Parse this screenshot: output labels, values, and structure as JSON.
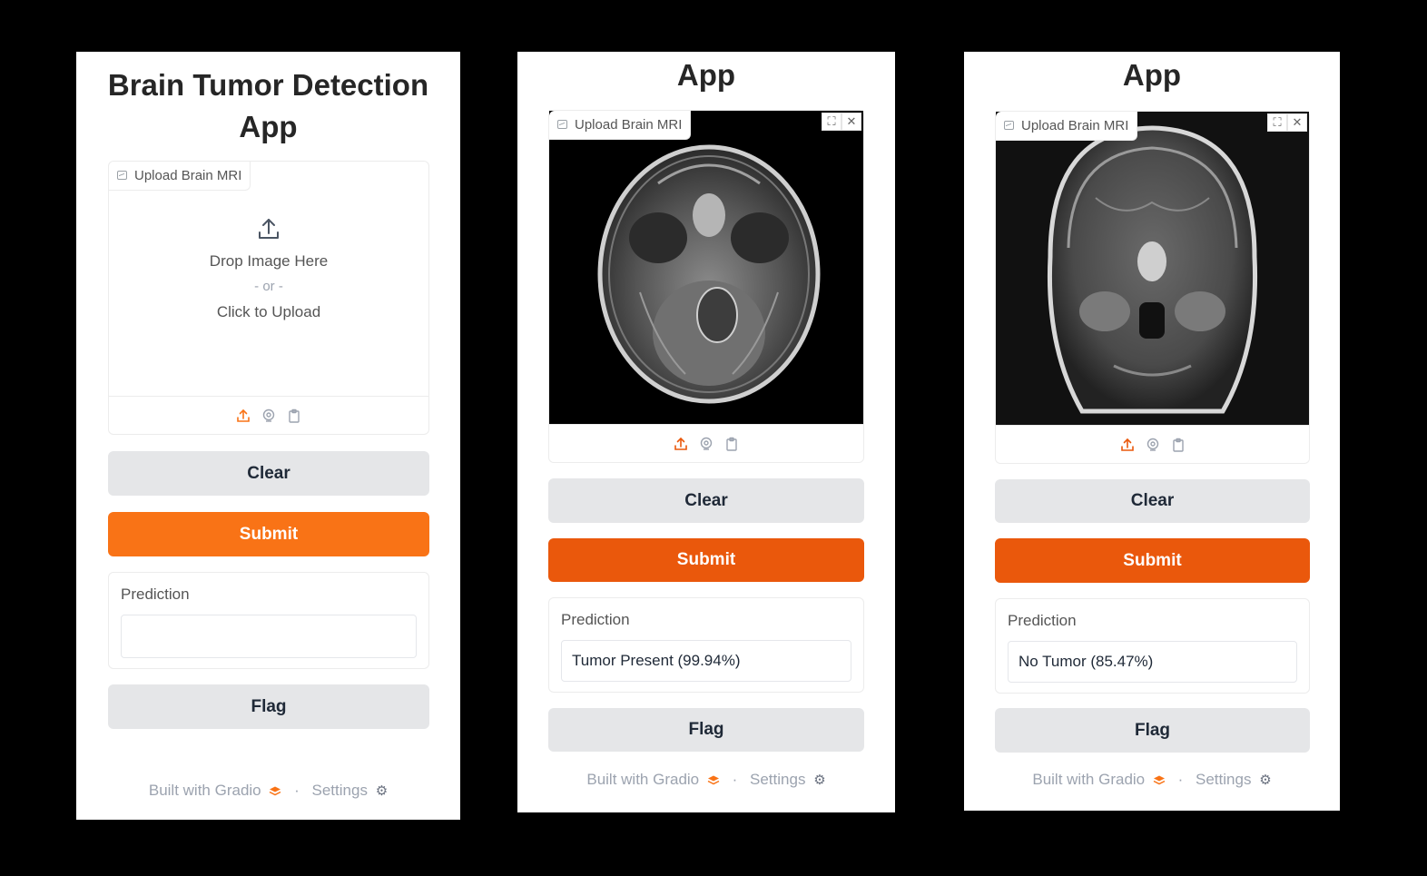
{
  "colors": {
    "accent": "#f97316",
    "accent_dark": "#ea580c",
    "secondary_button": "#e5e6e8",
    "background": "#000000"
  },
  "icons": {
    "upload": "upload-icon",
    "webcam": "webcam-icon",
    "clipboard": "clipboard-icon",
    "fullscreen": "fullscreen-icon",
    "close": "close-icon",
    "gradio_logo": "gradio-logo-icon",
    "settings": "gear-icon",
    "image_label": "image-icon"
  },
  "panels": [
    {
      "title": "Brain Tumor Detection App",
      "image_label": "Upload Brain MRI",
      "drop_text": "Drop Image Here",
      "or_text": "- or -",
      "click_text": "Click to Upload",
      "clear_label": "Clear",
      "submit_label": "Submit",
      "prediction_label": "Prediction",
      "prediction_value": "",
      "flag_label": "Flag",
      "footer_built": "Built with Gradio",
      "footer_sep": "·",
      "footer_settings": "Settings"
    },
    {
      "title": "App",
      "image_label": "Upload Brain MRI",
      "clear_label": "Clear",
      "submit_label": "Submit",
      "prediction_label": "Prediction",
      "prediction_value": "Tumor Present (99.94%)",
      "flag_label": "Flag",
      "footer_built": "Built with Gradio",
      "footer_sep": "·",
      "footer_settings": "Settings"
    },
    {
      "title": "App",
      "image_label": "Upload Brain MRI",
      "clear_label": "Clear",
      "submit_label": "Submit",
      "prediction_label": "Prediction",
      "prediction_value": "No Tumor (85.47%)",
      "flag_label": "Flag",
      "footer_built": "Built with Gradio",
      "footer_sep": "·",
      "footer_settings": "Settings"
    }
  ]
}
